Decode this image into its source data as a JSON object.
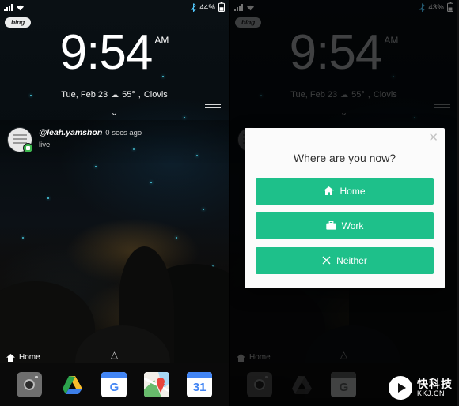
{
  "meta": {
    "accent_green": "#1ec08a",
    "background": "#000000"
  },
  "left_phone": {
    "statusbar": {
      "signal_icon": "signal-bars-icon",
      "wifi_icon": "wifi-icon",
      "bluetooth_icon": "bluetooth-icon",
      "battery_percent": "44%",
      "battery_icon": "battery-icon"
    },
    "search_chip": {
      "label": "bing"
    },
    "clock": {
      "time": "9:54",
      "ampm": "AM"
    },
    "date_line": {
      "date": "Tue, Feb 23",
      "weather_icon": "cloud-icon",
      "temperature": "55°",
      "location": "Clovis"
    },
    "expand_chevron": "chevron-down-icon",
    "notification": {
      "app_icon": "periscope-app-icon",
      "title": "@leah.yamshon",
      "time": "0 secs ago",
      "subtitle": "live",
      "handle_icon": "notification-handle-icon"
    },
    "bottom": {
      "home_icon": "home-icon",
      "home_label": "Home",
      "nav_up_icon": "chevron-up-icon"
    },
    "dock": [
      {
        "name": "camera",
        "label": "Camera"
      },
      {
        "name": "drive",
        "label": "Drive"
      },
      {
        "name": "calendar",
        "label": "Calendar",
        "day": "G"
      },
      {
        "name": "maps",
        "label": "Maps"
      },
      {
        "name": "calendar-date",
        "label": "Calendar",
        "day": "31"
      }
    ]
  },
  "right_phone": {
    "statusbar": {
      "signal_icon": "signal-bars-icon",
      "wifi_icon": "wifi-icon",
      "bluetooth_icon": "bluetooth-icon",
      "battery_percent": "43%",
      "battery_icon": "battery-icon"
    },
    "search_chip": {
      "label": "bing"
    },
    "clock": {
      "time": "9:54",
      "ampm": "AM"
    },
    "date_line": {
      "date": "Tue, Feb 23",
      "weather_icon": "cloud-icon",
      "temperature": "55°",
      "location": "Clovis"
    },
    "bottom": {
      "home_icon": "home-icon",
      "home_label": "Home",
      "nav_up_icon": "chevron-up-icon"
    },
    "dialog": {
      "close_icon": "close-icon",
      "title": "Where are you now?",
      "buttons": [
        {
          "icon": "home-icon",
          "glyph": "⌂",
          "label": "Home"
        },
        {
          "icon": "briefcase-icon",
          "glyph": "▮",
          "label": "Work"
        },
        {
          "icon": "close-x-icon",
          "glyph": "✕",
          "label": "Neither"
        }
      ]
    }
  },
  "watermark": {
    "cn": "快科技",
    "en": "KKJ.CN",
    "logo_icon": "play-logo-icon"
  }
}
